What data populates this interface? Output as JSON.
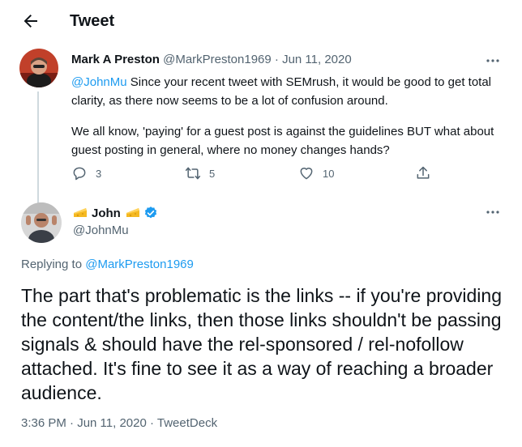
{
  "header": {
    "title": "Tweet",
    "back_icon": "arrow-left-icon"
  },
  "parent_tweet": {
    "author_name": "Mark A Preston",
    "author_handle": "@MarkPreston1969",
    "separator": "·",
    "date": "Jun 11, 2020",
    "mention": "@JohnMu",
    "text_line1_rest": " Since your recent tweet with SEMrush, it would be good to get total clarity, as there now seems to be a lot of confusion around.",
    "text_para2": "We all know, 'paying' for a guest post is against the guidelines BUT what about guest posting in general, where no money changes hands?",
    "reply_count": "3",
    "retweet_count": "5",
    "like_count": "10"
  },
  "main_tweet": {
    "author_name": "John",
    "author_handle": "@JohnMu",
    "verified": true,
    "replying_prefix": "Replying to",
    "replying_to": "@MarkPreston1969",
    "text": "The part that's problematic is the links -- if you're providing the content/the links, then those links shouldn't be passing signals & should have the rel-sponsored / rel-nofollow attached. It's fine to see it as a way of reaching a broader audience.",
    "timestamp": "3:36 PM · Jun 11, 2020 · TweetDeck"
  },
  "colors": {
    "accent": "#1d9bf0",
    "secondary_text": "#536471",
    "primary_text": "#0f1419",
    "divider": "#cfd9de"
  }
}
